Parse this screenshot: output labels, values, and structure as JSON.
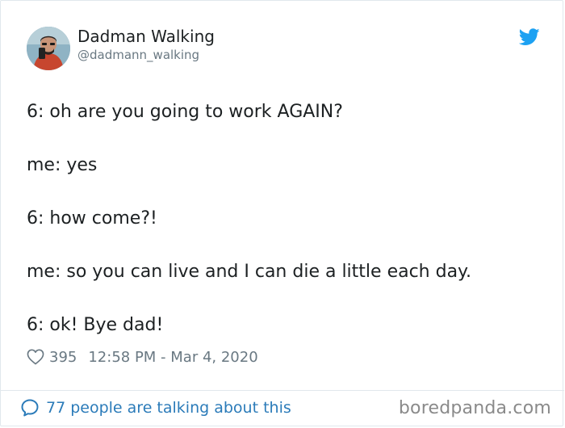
{
  "tweet": {
    "author": {
      "display_name": "Dadman Walking",
      "handle": "@dadmann_walking",
      "avatar_icon": "avatar-photo"
    },
    "brand_icon": "twitter-bird-icon",
    "lines": [
      "6: oh are you going to work AGAIN?",
      "me: yes",
      "6: how come?!",
      "me: so you can live and I can die a little each day.",
      "6: ok! Bye dad!"
    ],
    "likes": "395",
    "timestamp": "12:58 PM - Mar 4, 2020",
    "talking": "77 people are talking about this"
  },
  "watermark": "boredpanda.com",
  "colors": {
    "twitter_blue": "#1da1f2",
    "link_blue": "#2b7bb9",
    "muted_gray": "#697882",
    "text_dark": "#1c2022",
    "border": "#e1e8ed"
  }
}
